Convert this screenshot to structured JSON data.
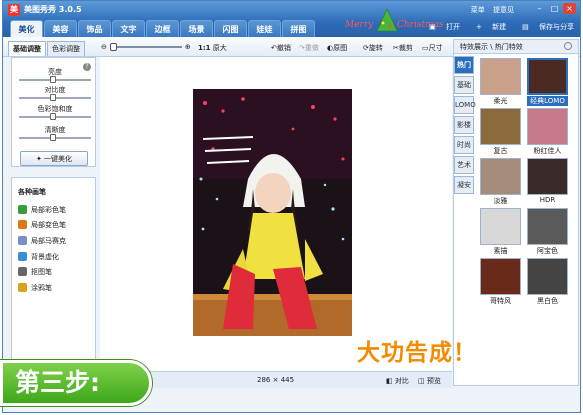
{
  "app": {
    "title": "美图秀秀 3.0.5",
    "icon": "meitu-logo-icon"
  },
  "menu_links": [
    "菜单",
    "提意见"
  ],
  "tabs": [
    {
      "label": "美化",
      "active": true
    },
    {
      "label": "美容"
    },
    {
      "label": "饰品"
    },
    {
      "label": "文字"
    },
    {
      "label": "边框"
    },
    {
      "label": "场景"
    },
    {
      "label": "闪图"
    },
    {
      "label": "娃娃"
    },
    {
      "label": "拼图"
    }
  ],
  "banner": {
    "text_merry": "Merry",
    "text_christmas": "Christmas"
  },
  "top_actions": {
    "open": "打开",
    "new": "新建",
    "save_share": "保存与分享"
  },
  "subtabs": [
    {
      "label": "基础调整",
      "active": true
    },
    {
      "label": "色彩调整"
    }
  ],
  "toolbar": {
    "zoom_ratio": "1:1",
    "original_size": "原大",
    "undo": "撤销",
    "redo": "重做",
    "reset": "原图",
    "rotate": "旋转",
    "crop": "裁剪",
    "resize": "尺寸"
  },
  "adjust": {
    "sliders": [
      {
        "label": "亮度",
        "value": 0.5
      },
      {
        "label": "对比度",
        "value": 0.5
      },
      {
        "label": "色彩饱和度",
        "value": 0.5
      },
      {
        "label": "清晰度",
        "value": 0.5
      }
    ],
    "one_click": "一键美化"
  },
  "brushes": {
    "title": "各种画笔",
    "items": [
      {
        "label": "局部彩色笔",
        "color": "#3a9d3a"
      },
      {
        "label": "局部变色笔",
        "color": "#d97a1a"
      },
      {
        "label": "局部马赛克",
        "color": "#7a8ec8"
      },
      {
        "label": "背景虚化",
        "color": "#3a8fd0"
      },
      {
        "label": "抠图笔",
        "color": "#666666"
      },
      {
        "label": "涂鸦笔",
        "color": "#d9a21a"
      }
    ]
  },
  "status": {
    "width": "286",
    "times": "×",
    "height": "445",
    "compare": "对比",
    "preview": "预览"
  },
  "right_panel": {
    "header": "特效展示 \\ 热门特效",
    "vtabs": [
      {
        "label": "热门",
        "active": true
      },
      {
        "label": "基础"
      },
      {
        "label": "LOMO"
      },
      {
        "label": "影楼"
      },
      {
        "label": "时尚"
      },
      {
        "label": "艺术"
      },
      {
        "label": "凝安"
      }
    ],
    "thumbs": [
      {
        "label": "柔光"
      },
      {
        "label": "经典LOMO",
        "selected": true
      },
      {
        "label": "复古"
      },
      {
        "label": "粉红佳人"
      },
      {
        "label": "淡雅"
      },
      {
        "label": "HDR"
      },
      {
        "label": "素描"
      },
      {
        "label": "阿宝色"
      },
      {
        "label": "哥特风"
      },
      {
        "label": "黑白色"
      }
    ]
  },
  "overlay": {
    "step": "第三步:",
    "done": "大功告成！"
  }
}
